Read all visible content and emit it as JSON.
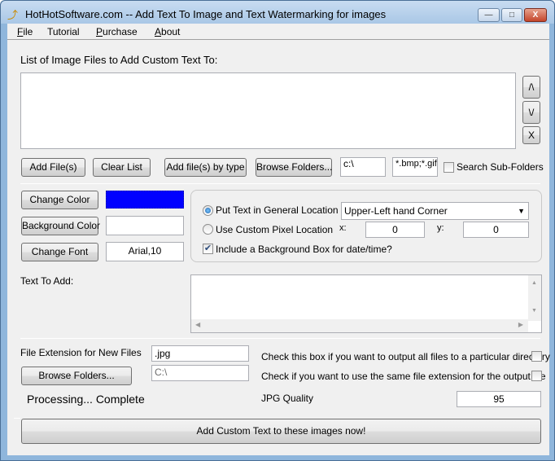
{
  "window": {
    "title": "HotHotSoftware.com -- Add Text To Image and Text Watermarking for images",
    "minimize": "—",
    "maximize": "□",
    "close": "X"
  },
  "menu": {
    "file": {
      "accel": "F",
      "rest": "ile"
    },
    "tutorial": "Tutorial",
    "purchase": {
      "accel": "P",
      "rest": "urchase"
    },
    "about": {
      "accel": "A",
      "rest": "bout"
    }
  },
  "files": {
    "list_label": "List of Image Files to Add Custom Text To:",
    "move_up": "/\\",
    "move_down": "\\/",
    "remove": "X",
    "add_files": "Add File(s)",
    "clear_list": "Clear List",
    "add_by_type": "Add file(s) by type",
    "browse_folders": "Browse Folders...",
    "folder_value": "c:\\",
    "types_value": "*.bmp;*.gif;",
    "search_subfolders": "Search Sub-Folders",
    "search_subfolders_checked": false
  },
  "style": {
    "change_color": "Change Color",
    "text_color": "#0000ff",
    "background_color": "Background Color",
    "background_value": "#ffffff",
    "change_font": "Change Font",
    "font_value": "Arial,10"
  },
  "location": {
    "general_label": "Put Text in General Location",
    "general_selected": true,
    "general_value": "Upper-Left hand Corner",
    "custom_label": "Use Custom Pixel Location",
    "x_label": "x:",
    "x_value": "0",
    "y_label": "y:",
    "y_value": "0",
    "bg_box_label": "Include a Background Box for date/time?",
    "bg_box_checked": true
  },
  "text": {
    "label": "Text To Add:",
    "value": ""
  },
  "output": {
    "ext_label": "File Extension for New Files",
    "ext_value": ".jpg",
    "browse_folders": "Browse Folders...",
    "dir_value": "C:\\",
    "output_dir_label": "Check this box if you want to output all files to a particular directory",
    "output_dir_checked": false,
    "same_ext_label": "Check if you want to use the same file extension for the output file",
    "same_ext_checked": false,
    "status": "Processing... Complete",
    "jpg_quality_label": "JPG Quality",
    "jpg_quality_value": "95",
    "run_button": "Add Custom Text to these images now!"
  }
}
